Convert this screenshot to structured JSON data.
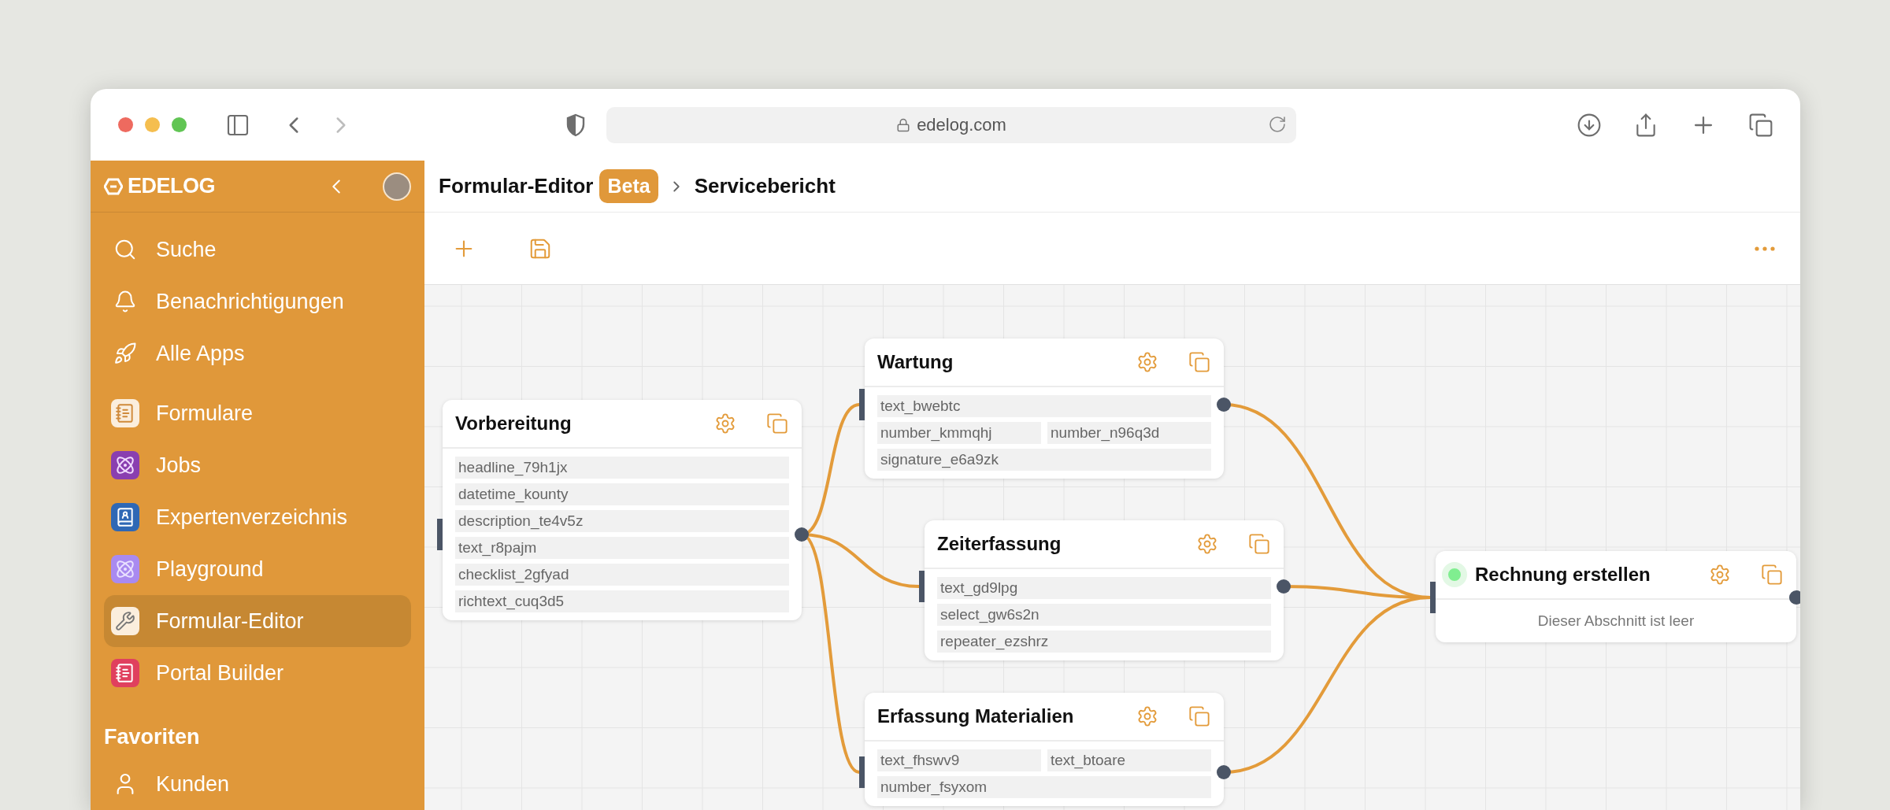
{
  "browser": {
    "url": "edelog.com",
    "back": {
      "disabled": false
    },
    "forward": {
      "disabled": true
    }
  },
  "sidebar": {
    "logo": "EDELOG",
    "items": [
      {
        "label": "Suche",
        "kind": "nav",
        "selected": false
      },
      {
        "label": "Benachrichtigungen",
        "kind": "nav",
        "selected": false
      },
      {
        "label": "Alle Apps",
        "kind": "nav",
        "selected": false
      },
      {
        "label": "Formulare",
        "kind": "app",
        "selected": false
      },
      {
        "label": "Jobs",
        "kind": "app",
        "selected": false
      },
      {
        "label": "Expertenverzeichnis",
        "kind": "app",
        "selected": false
      },
      {
        "label": "Playground",
        "kind": "app",
        "selected": false
      },
      {
        "label": "Formular-Editor",
        "kind": "app",
        "selected": true
      },
      {
        "label": "Portal Builder",
        "kind": "app",
        "selected": false
      }
    ],
    "favorites": {
      "title": "Favoriten",
      "items": [
        {
          "label": "Kunden",
          "selected": false
        }
      ]
    }
  },
  "header": {
    "breadcrumb": [
      {
        "label": "Formular-Editor",
        "badge": "Beta"
      },
      {
        "label": "Servicebericht"
      }
    ]
  },
  "canvas": {
    "nodes": [
      {
        "title": "Vorbereitung",
        "active": false,
        "rows": [
          [
            "headline_79h1jx"
          ],
          [
            "datetime_kounty"
          ],
          [
            "description_te4v5z"
          ],
          [
            "text_r8pajm"
          ],
          [
            "checklist_2gfyad"
          ],
          [
            "richtext_cuq3d5"
          ]
        ]
      },
      {
        "title": "Wartung",
        "active": false,
        "rows": [
          [
            "text_bwebtc"
          ],
          [
            "number_kmmqhj",
            "number_n96q3d"
          ],
          [
            "signature_e6a9zk"
          ]
        ]
      },
      {
        "title": "Zeiterfassung",
        "active": false,
        "rows": [
          [
            "text_gd9lpg"
          ],
          [
            "select_gw6s2n"
          ],
          [
            "repeater_ezshrz"
          ]
        ]
      },
      {
        "title": "Erfassung Materialien",
        "active": false,
        "rows": [
          [
            "text_fhswv9",
            "text_btoare"
          ],
          [
            "number_fsyxom"
          ]
        ]
      },
      {
        "title": "Rechnung erstellen",
        "active": true,
        "empty_text": "Dieser Abschnitt ist leer"
      }
    ]
  }
}
